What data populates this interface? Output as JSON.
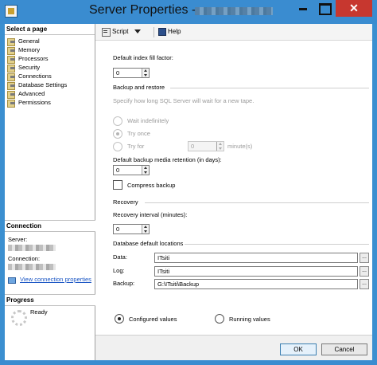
{
  "window": {
    "title": "Server Properties -",
    "close_glyph": "✕"
  },
  "left": {
    "select_page_header": "Select a page",
    "pages": [
      {
        "label": "General"
      },
      {
        "label": "Memory"
      },
      {
        "label": "Processors"
      },
      {
        "label": "Security"
      },
      {
        "label": "Connections"
      },
      {
        "label": "Database Settings"
      },
      {
        "label": "Advanced"
      },
      {
        "label": "Permissions"
      }
    ],
    "connection_header": "Connection",
    "server_label": "Server:",
    "connection_label": "Connection:",
    "view_connection_link": "View connection properties",
    "progress_header": "Progress",
    "progress_status": "Ready"
  },
  "toolbar": {
    "script_label": "Script",
    "help_label": "Help"
  },
  "form": {
    "fill_factor_label": "Default index fill factor:",
    "fill_factor_value": "0",
    "backup_restore_title": "Backup and restore",
    "backup_desc": "Specify how long SQL Server will wait for a new tape.",
    "wait_indefinitely": "Wait indefinitely",
    "try_once": "Try once",
    "try_for": "Try for",
    "try_for_value": "0",
    "minutes_unit": "minute(s)",
    "retention_label": "Default backup media retention (in days):",
    "retention_value": "0",
    "compress_backup": "Compress backup",
    "recovery_title": "Recovery",
    "recovery_interval_label": "Recovery interval (minutes):",
    "recovery_interval_value": "0",
    "db_locations_title": "Database default locations",
    "data_label": "Data:",
    "data_value": "ITsiti",
    "log_label": "Log:",
    "log_value": "ITsiti",
    "backup_label": "Backup:",
    "backup_value": "G:\\ITsiti\\Backup",
    "browse_glyph": "...",
    "configured_values": "Configured values",
    "running_values": "Running values"
  },
  "footer": {
    "ok_label": "OK",
    "cancel_label": "Cancel"
  }
}
